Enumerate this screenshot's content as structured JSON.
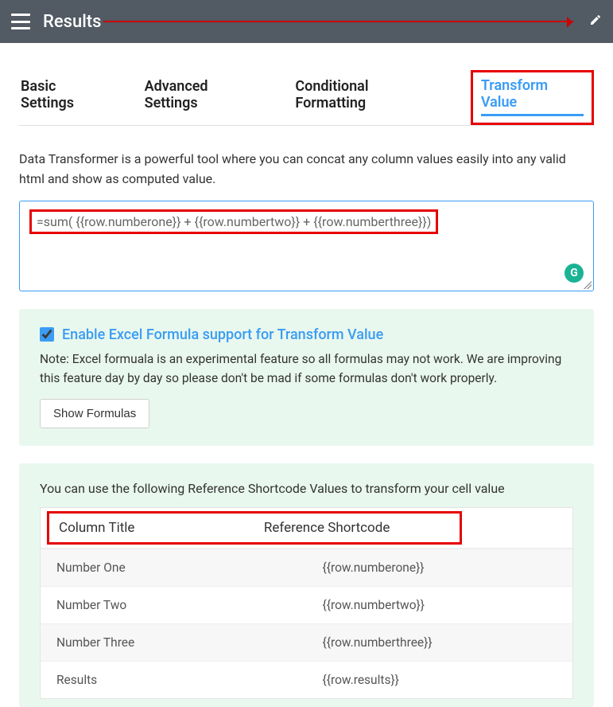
{
  "topbar": {
    "title": "Results"
  },
  "tabs": {
    "basic": "Basic Settings",
    "advanced": "Advanced Settings",
    "conditional": "Conditional Formatting",
    "transform": "Transform Value"
  },
  "description": "Data Transformer is a powerful tool where you can concat any column values easily into any valid html and show as computed value.",
  "formula": "=sum( {{row.numberone}} + {{row.numbertwo}} + {{row.numberthree}})",
  "excel_panel": {
    "checkbox_label": "Enable Excel Formula support for Transform Value",
    "note": "Note: Excel formuala is an experimental feature so all formulas may not work. We are improving this feature day by day so please don't be mad if some formulas don't work properly.",
    "show_formulas": "Show Formulas"
  },
  "shortcode_panel": {
    "intro": "You can use the following Reference Shortcode Values to transform your cell value",
    "col1": "Column Title",
    "col2": "Reference Shortcode",
    "rows": [
      {
        "title": "Number One",
        "code": "{{row.numberone}}"
      },
      {
        "title": "Number Two",
        "code": "{{row.numbertwo}}"
      },
      {
        "title": "Number Three",
        "code": "{{row.numberthree}}"
      },
      {
        "title": "Results",
        "code": "{{row.results}}"
      }
    ]
  }
}
